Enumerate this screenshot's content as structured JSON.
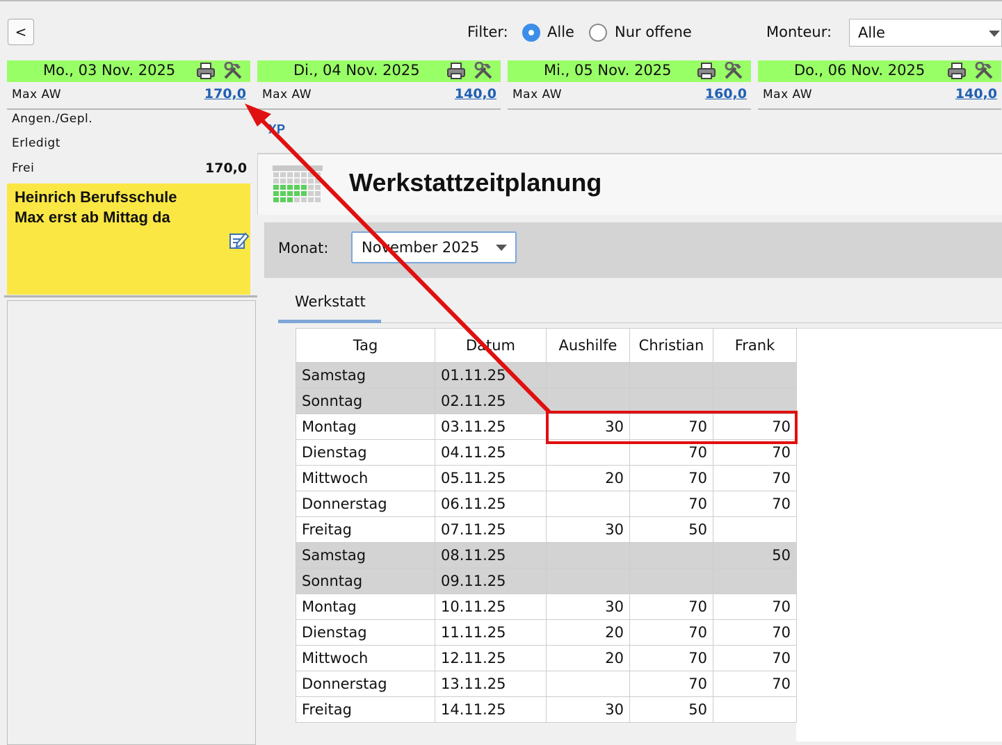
{
  "toolbar": {
    "back_label": "<",
    "filter_label": "Filter:",
    "filter_options": [
      {
        "label": "Alle",
        "selected": true
      },
      {
        "label": "Nur offene",
        "selected": false
      }
    ],
    "monteur_label": "Monteur:",
    "monteur_value": "Alle"
  },
  "days": [
    {
      "title": "Mo., 03 Nov. 2025",
      "max_label": "Max AW",
      "max_value": "170,0"
    },
    {
      "title": "Di., 04 Nov. 2025",
      "max_label": "Max AW",
      "max_value": "140,0"
    },
    {
      "title": "Mi., 05 Nov. 2025",
      "max_label": "Max AW",
      "max_value": "160,0"
    },
    {
      "title": "Do., 06 Nov. 2025",
      "max_label": "Max AW",
      "max_value": "140,0"
    }
  ],
  "day_detail": {
    "angen_label": "Angen./Gepl.",
    "erledigt_label": "Erledigt",
    "frei_label": "Frei",
    "frei_value": "170,0",
    "note_line1": "Heinrich Berufsschule",
    "note_line2": "Max erst ab Mittag da"
  },
  "planner": {
    "logo_text": "XP",
    "title": "Werkstattzeitplanung",
    "month_label": "Monat:",
    "month_value": "November 2025",
    "tab": "Werkstatt",
    "columns": [
      "Tag",
      "Datum",
      "Aushilfe",
      "Christian",
      "Frank"
    ],
    "rows": [
      {
        "tag": "Samstag",
        "datum": "01.11.25",
        "aushilfe": "",
        "christian": "",
        "frank": "",
        "weekend": true
      },
      {
        "tag": "Sonntag",
        "datum": "02.11.25",
        "aushilfe": "",
        "christian": "",
        "frank": "",
        "weekend": true
      },
      {
        "tag": "Montag",
        "datum": "03.11.25",
        "aushilfe": "30",
        "christian": "70",
        "frank": "70",
        "weekend": false
      },
      {
        "tag": "Dienstag",
        "datum": "04.11.25",
        "aushilfe": "",
        "christian": "70",
        "frank": "70",
        "weekend": false
      },
      {
        "tag": "Mittwoch",
        "datum": "05.11.25",
        "aushilfe": "20",
        "christian": "70",
        "frank": "70",
        "weekend": false
      },
      {
        "tag": "Donnerstag",
        "datum": "06.11.25",
        "aushilfe": "",
        "christian": "70",
        "frank": "70",
        "weekend": false
      },
      {
        "tag": "Freitag",
        "datum": "07.11.25",
        "aushilfe": "30",
        "christian": "50",
        "frank": "",
        "weekend": false
      },
      {
        "tag": "Samstag",
        "datum": "08.11.25",
        "aushilfe": "",
        "christian": "",
        "frank": "50",
        "weekend": true
      },
      {
        "tag": "Sonntag",
        "datum": "09.11.25",
        "aushilfe": "",
        "christian": "",
        "frank": "",
        "weekend": true
      },
      {
        "tag": "Montag",
        "datum": "10.11.25",
        "aushilfe": "30",
        "christian": "70",
        "frank": "70",
        "weekend": false
      },
      {
        "tag": "Dienstag",
        "datum": "11.11.25",
        "aushilfe": "20",
        "christian": "70",
        "frank": "70",
        "weekend": false
      },
      {
        "tag": "Mittwoch",
        "datum": "12.11.25",
        "aushilfe": "20",
        "christian": "70",
        "frank": "70",
        "weekend": false
      },
      {
        "tag": "Donnerstag",
        "datum": "13.11.25",
        "aushilfe": "",
        "christian": "70",
        "frank": "70",
        "weekend": false
      },
      {
        "tag": "Freitag",
        "datum": "14.11.25",
        "aushilfe": "30",
        "christian": "50",
        "frank": "",
        "weekend": false
      }
    ]
  },
  "annotation_color": "#e01010"
}
